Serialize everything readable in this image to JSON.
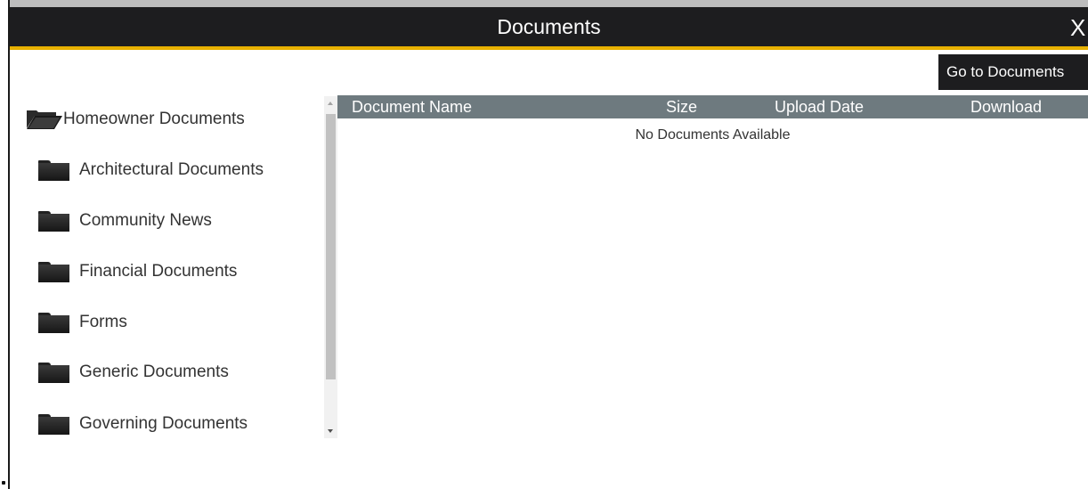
{
  "dialog": {
    "title": "Documents",
    "close_label": "X",
    "go_to_documents_label": "Go to Documents"
  },
  "tree": {
    "root": {
      "label": "Homeowner Documents",
      "icon": "folder-open-icon"
    },
    "items": [
      {
        "label": "Architectural Documents",
        "icon": "folder-icon"
      },
      {
        "label": "Community News",
        "icon": "folder-icon"
      },
      {
        "label": "Financial Documents",
        "icon": "folder-icon"
      },
      {
        "label": "Forms",
        "icon": "folder-icon"
      },
      {
        "label": "Generic Documents",
        "icon": "folder-icon"
      },
      {
        "label": "Governing Documents",
        "icon": "folder-icon"
      }
    ]
  },
  "grid": {
    "columns": [
      "Document Name",
      "Size",
      "Upload Date",
      "Download"
    ],
    "empty_message": "No Documents Available"
  },
  "colors": {
    "titlebar_bg": "#1d1d1f",
    "titlebar_accent": "#e8b100",
    "grid_header_bg": "#6e7a7f"
  }
}
